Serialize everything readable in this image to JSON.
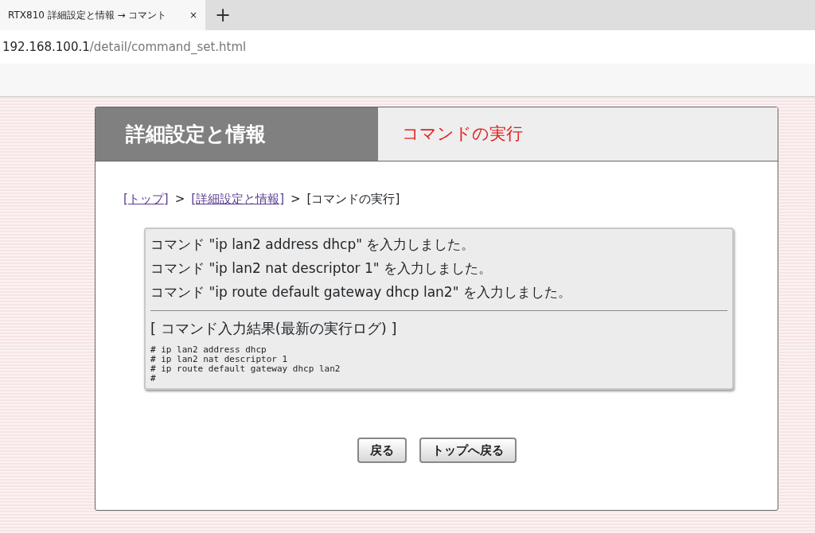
{
  "browser": {
    "tab_title": "RTX810 詳細設定と情報 → コマント",
    "tab_close": "×",
    "new_tab": "+",
    "url_host": "192.168.100.1",
    "url_path": "/detail/command_set.html"
  },
  "header": {
    "section_title": "詳細設定と情報",
    "page_title": "コマンドの実行"
  },
  "breadcrumb": [
    {
      "kind": "link",
      "label": "[トップ]"
    },
    {
      "kind": "separator",
      "label": ">"
    },
    {
      "kind": "link",
      "label": "[詳細設定と情報]"
    },
    {
      "kind": "separator",
      "label": ">"
    },
    {
      "kind": "current",
      "label": "[コマンドの実行]"
    }
  ],
  "messages": [
    "コマンド \"ip lan2 address dhcp\" を入力しました。",
    "コマンド \"ip lan2 nat descriptor 1\" を入力しました。",
    "コマンド \"ip route default gateway dhcp lan2\" を入力しました。"
  ],
  "result_title": "[ コマンド入力結果(最新の実行ログ) ]",
  "log_lines": [
    "# ip lan2 address dhcp",
    "# ip lan2 nat descriptor 1",
    "# ip route default gateway dhcp lan2",
    "#"
  ],
  "buttons": [
    "戻る",
    "トップへ戻る"
  ]
}
